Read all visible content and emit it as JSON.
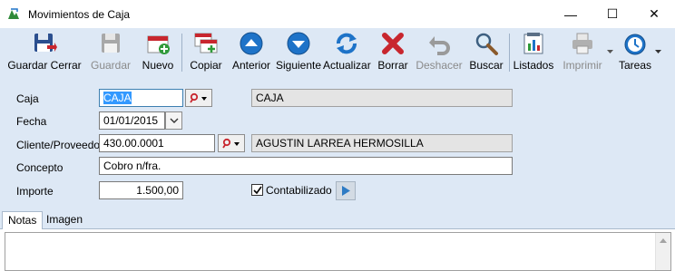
{
  "window": {
    "title": "Movimientos de Caja"
  },
  "window_buttons": {
    "minimize": "—",
    "maximize": "☐",
    "close": "✕"
  },
  "toolbar": {
    "items": [
      {
        "label": "Guardar Cerrar",
        "icon": "save-close-icon",
        "enabled": true
      },
      {
        "label": "Guardar",
        "icon": "save-icon",
        "enabled": false
      },
      {
        "label": "Nuevo",
        "icon": "new-icon",
        "enabled": true
      },
      {
        "label": "Copiar",
        "icon": "copy-icon",
        "enabled": true
      },
      {
        "label": "Anterior",
        "icon": "previous-icon",
        "enabled": true
      },
      {
        "label": "Siguiente",
        "icon": "next-icon",
        "enabled": true
      },
      {
        "label": "Actualizar",
        "icon": "refresh-icon",
        "enabled": true
      },
      {
        "label": "Borrar",
        "icon": "delete-icon",
        "enabled": true
      },
      {
        "label": "Deshacer",
        "icon": "undo-icon",
        "enabled": false
      },
      {
        "label": "Buscar",
        "icon": "search-icon",
        "enabled": true
      },
      {
        "label": "Listados",
        "icon": "reports-icon",
        "enabled": true
      },
      {
        "label": "Imprimir",
        "icon": "print-icon",
        "enabled": false
      },
      {
        "label": "Tareas",
        "icon": "tasks-icon",
        "enabled": true
      }
    ]
  },
  "form": {
    "caja": {
      "label": "Caja",
      "value": "CAJA",
      "description": "CAJA"
    },
    "fecha": {
      "label": "Fecha",
      "value": "01/01/2015"
    },
    "cliente": {
      "label": "Cliente/Proveedor",
      "value": "430.00.0001",
      "description": "AGUSTIN LARREA HERMOSILLA"
    },
    "concepto": {
      "label": "Concepto",
      "value": "Cobro n/fra."
    },
    "importe": {
      "label": "Importe",
      "value": "1.500,00"
    },
    "contabilizado": {
      "label": "Contabilizado",
      "checked": true
    }
  },
  "tabs": [
    {
      "label": "Notas",
      "active": true
    },
    {
      "label": "Imagen",
      "active": false
    }
  ],
  "colors": {
    "toolbar_bg": "#dde8f5",
    "accent_blue": "#1e73c8",
    "delete_red": "#c8262e",
    "selection": "#3399ff"
  }
}
